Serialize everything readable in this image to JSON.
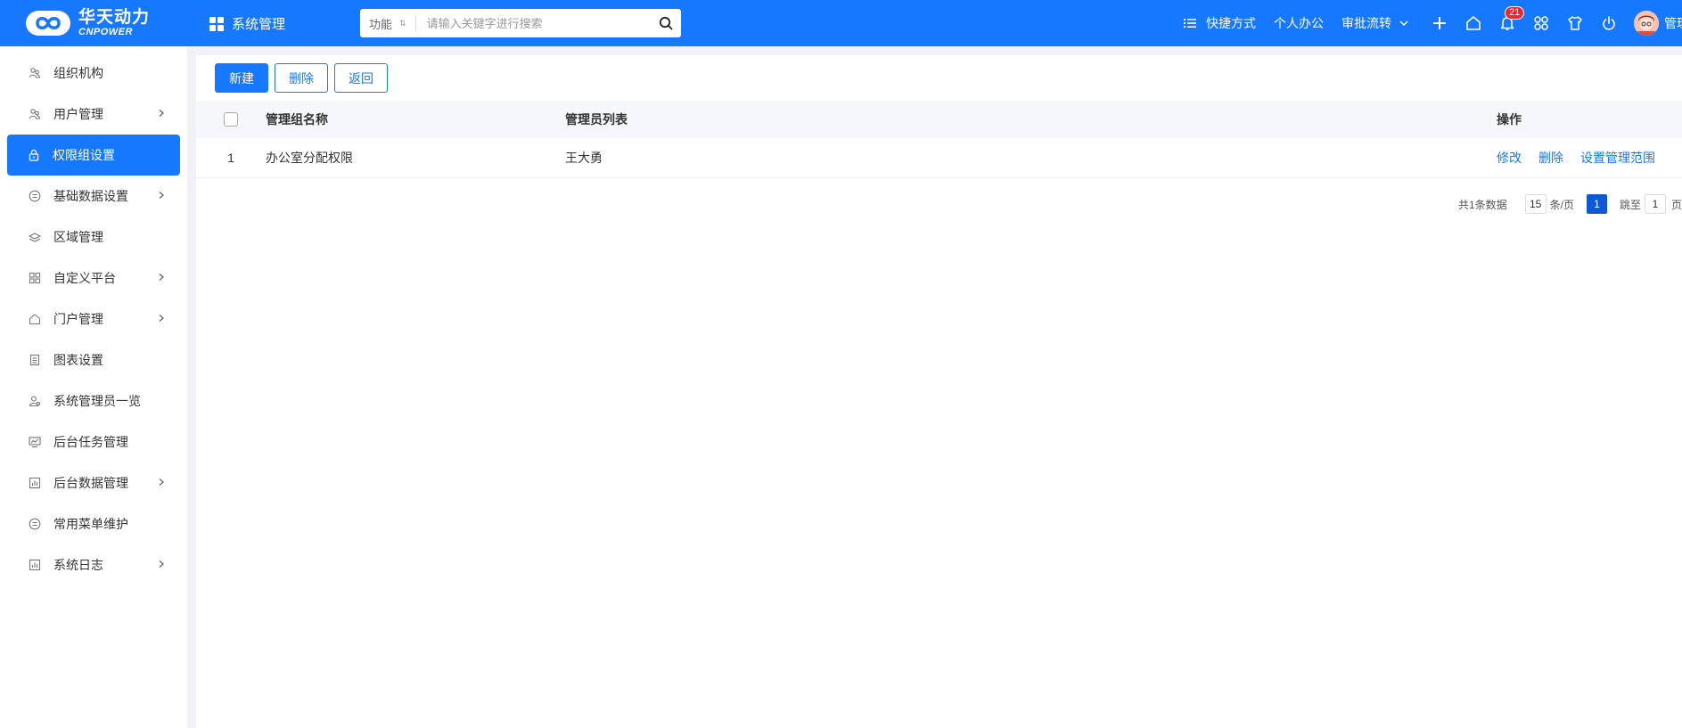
{
  "header": {
    "logo_cn": "华天动力",
    "logo_en": "CNPOWER",
    "system_menu": "系统管理",
    "search": {
      "type": "功能",
      "placeholder": "请输入关键字进行搜索"
    },
    "links": [
      "快捷方式",
      "个人办公",
      "审批流转"
    ],
    "notification_count": "21",
    "user": "管理"
  },
  "sidebar": {
    "items": [
      {
        "label": "组织机构",
        "icon": "org-icon",
        "arrow": false,
        "active": false
      },
      {
        "label": "用户管理",
        "icon": "users-icon",
        "arrow": true,
        "active": false
      },
      {
        "label": "权限组设置",
        "icon": "lock-icon",
        "arrow": false,
        "active": true
      },
      {
        "label": "基础数据设置",
        "icon": "list-circle-icon",
        "arrow": true,
        "active": false
      },
      {
        "label": "区域管理",
        "icon": "region-icon",
        "arrow": false,
        "active": false
      },
      {
        "label": "自定义平台",
        "icon": "apps-icon",
        "arrow": true,
        "active": false
      },
      {
        "label": "门户管理",
        "icon": "home-icon",
        "arrow": true,
        "active": false
      },
      {
        "label": "图表设置",
        "icon": "chart-icon",
        "arrow": false,
        "active": false
      },
      {
        "label": "系统管理员一览",
        "icon": "admin-icon",
        "arrow": false,
        "active": false
      },
      {
        "label": "后台任务管理",
        "icon": "monitor-icon",
        "arrow": false,
        "active": false
      },
      {
        "label": "后台数据管理",
        "icon": "data-icon",
        "arrow": true,
        "active": false
      },
      {
        "label": "常用菜单维护",
        "icon": "list-circle-icon",
        "arrow": false,
        "active": false
      },
      {
        "label": "系统日志",
        "icon": "log-icon",
        "arrow": true,
        "active": false
      }
    ]
  },
  "toolbar": {
    "new": "新建",
    "delete": "删除",
    "back": "返回"
  },
  "table": {
    "headers": {
      "name": "管理组名称",
      "admins": "管理员列表",
      "ops": "操作"
    },
    "rows": [
      {
        "index": "1",
        "name": "办公室分配权限",
        "admins": "王大勇",
        "ops": [
          "修改",
          "删除",
          "设置管理范围"
        ]
      }
    ]
  },
  "pagination": {
    "total": "共1条数据",
    "page_size": "15",
    "per_page": "条/页",
    "current": "1",
    "goto_prefix": "跳至",
    "goto_value": "1",
    "goto_suffix": "页"
  },
  "colors": {
    "brand": "#1677ff",
    "badge": "#f5222d"
  }
}
